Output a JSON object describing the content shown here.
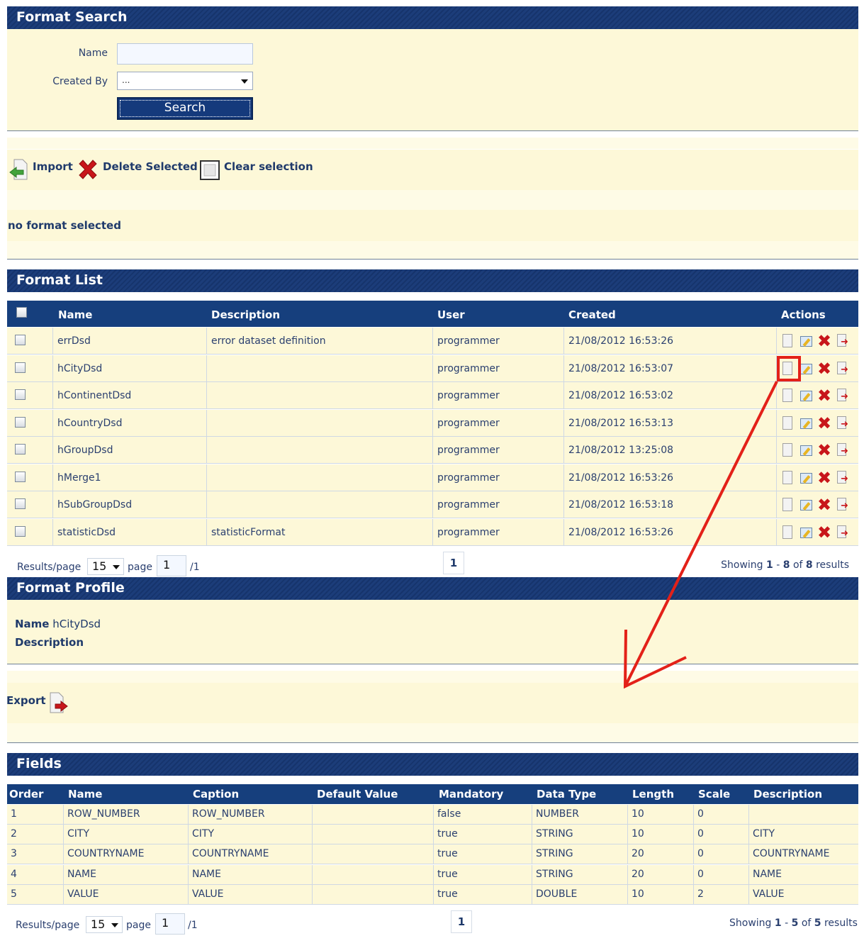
{
  "format_search": {
    "title": "Format Search",
    "name_label": "Name",
    "name_value": "",
    "created_by_label": "Created By",
    "created_by_value": "...",
    "search_label": "Search"
  },
  "toolbar": {
    "import_label": "Import",
    "delete_label": "Delete Selected",
    "clear_label": "Clear selection"
  },
  "selection_status": "no format selected",
  "format_list": {
    "title": "Format List",
    "columns": [
      "Name",
      "Description",
      "User",
      "Created",
      "Actions"
    ],
    "rows": [
      {
        "name": "errDsd",
        "description": "error dataset definition",
        "user": "programmer",
        "created": "21/08/2012 16:53:26"
      },
      {
        "name": "hCityDsd",
        "description": "",
        "user": "programmer",
        "created": "21/08/2012 16:53:07"
      },
      {
        "name": "hContinentDsd",
        "description": "",
        "user": "programmer",
        "created": "21/08/2012 16:53:02"
      },
      {
        "name": "hCountryDsd",
        "description": "",
        "user": "programmer",
        "created": "21/08/2012 16:53:13"
      },
      {
        "name": "hGroupDsd",
        "description": "",
        "user": "programmer",
        "created": "21/08/2012 13:25:08"
      },
      {
        "name": "hMerge1",
        "description": "",
        "user": "programmer",
        "created": "21/08/2012 16:53:26"
      },
      {
        "name": "hSubGroupDsd",
        "description": "",
        "user": "programmer",
        "created": "21/08/2012 16:53:18"
      },
      {
        "name": "statisticDsd",
        "description": "statisticFormat",
        "user": "programmer",
        "created": "21/08/2012 16:53:26"
      }
    ],
    "pager": {
      "results_label": "Results/page",
      "per_page": "15",
      "page_label": "page",
      "page": "1",
      "total_pages": "/1",
      "current": "1",
      "showing_prefix": "Showing",
      "from": "1",
      "dash": "-",
      "to": "8",
      "of": "of",
      "total": "8",
      "suffix": "results"
    }
  },
  "format_profile": {
    "title": "Format Profile",
    "name_label": "Name",
    "name_value": "hCityDsd",
    "description_label": "Description",
    "export_label": "Export"
  },
  "fields": {
    "title": "Fields",
    "columns": [
      "Order",
      "Name",
      "Caption",
      "Default Value",
      "Mandatory",
      "Data Type",
      "Length",
      "Scale",
      "Description"
    ],
    "rows": [
      [
        "1",
        "ROW_NUMBER",
        "ROW_NUMBER",
        "",
        "false",
        "NUMBER",
        "10",
        "0",
        ""
      ],
      [
        "2",
        "CITY",
        "CITY",
        "",
        "true",
        "STRING",
        "10",
        "0",
        "CITY"
      ],
      [
        "3",
        "COUNTRYNAME",
        "COUNTRYNAME",
        "",
        "true",
        "STRING",
        "20",
        "0",
        "COUNTRYNAME"
      ],
      [
        "4",
        "NAME",
        "NAME",
        "",
        "true",
        "STRING",
        "20",
        "0",
        "NAME"
      ],
      [
        "5",
        "VALUE",
        "VALUE",
        "",
        "true",
        "DOUBLE",
        "10",
        "2",
        "VALUE"
      ]
    ],
    "pager": {
      "results_label": "Results/page",
      "per_page": "15",
      "page_label": "page",
      "page": "1",
      "total_pages": "/1",
      "current": "1",
      "showing_prefix": "Showing",
      "from": "1",
      "dash": "-",
      "to": "5",
      "of": "of",
      "total": "5",
      "suffix": "results"
    }
  },
  "icons": {
    "import": "import-icon",
    "delete": "delete-icon",
    "clear": "clear-selection-icon",
    "view": "view-icon",
    "edit": "edit-icon",
    "remove": "remove-icon",
    "export": "export-icon"
  },
  "colors": {
    "header_blue": "#163f7d",
    "cream": "#fdf8d8",
    "annotation_red": "#e32119",
    "delete_red": "#c8161a"
  }
}
